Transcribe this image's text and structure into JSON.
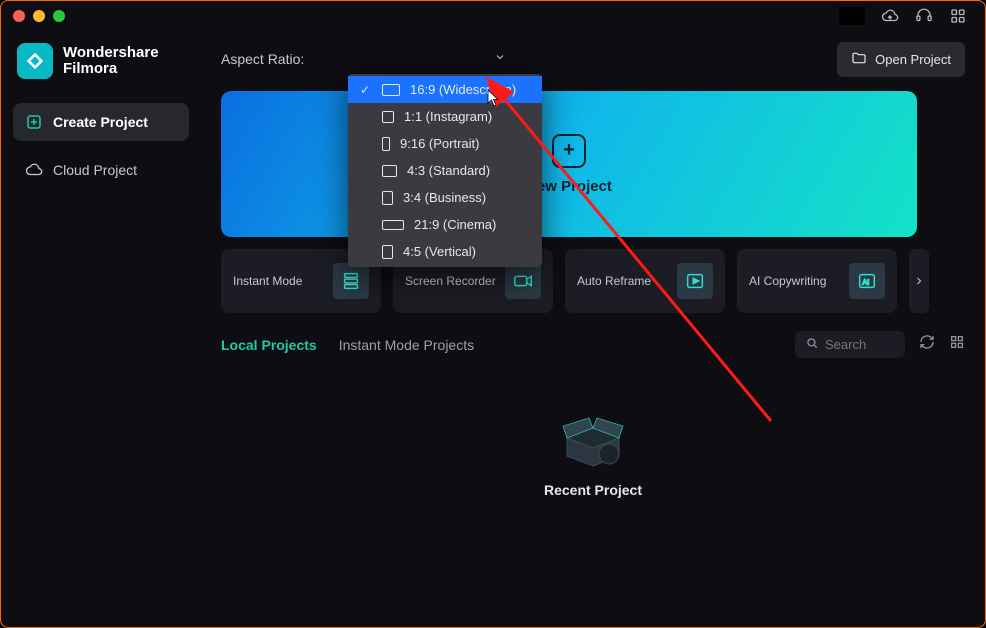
{
  "app": {
    "title_line1": "Wondershare",
    "title_line2": "Filmora"
  },
  "sidebar": {
    "items": [
      {
        "label": "Create Project",
        "icon": "plus-square-icon",
        "active": true
      },
      {
        "label": "Cloud Project",
        "icon": "cloud-icon",
        "active": false
      }
    ]
  },
  "toolbar": {
    "aspect_label": "Aspect Ratio:",
    "open_project_label": "Open Project"
  },
  "aspect_ratio": {
    "options": [
      {
        "label": "16:9 (Widescreen)",
        "shape": "wide",
        "selected": true
      },
      {
        "label": "1:1 (Instagram)",
        "shape": "square",
        "selected": false
      },
      {
        "label": "9:16 (Portrait)",
        "shape": "portrait",
        "selected": false
      },
      {
        "label": "4:3 (Standard)",
        "shape": "fourthree",
        "selected": false
      },
      {
        "label": "3:4 (Business)",
        "shape": "threefour",
        "selected": false
      },
      {
        "label": "21:9 (Cinema)",
        "shape": "wide21",
        "selected": false
      },
      {
        "label": "4:5 (Vertical)",
        "shape": "fourfive",
        "selected": false
      }
    ]
  },
  "hero": {
    "label": "New Project"
  },
  "tiles": [
    {
      "label": "Instant Mode"
    },
    {
      "label": "Screen Recorder"
    },
    {
      "label": "Auto Reframe"
    },
    {
      "label": "AI Copywriting"
    }
  ],
  "tabs": {
    "local": "Local Projects",
    "instant": "Instant Mode Projects"
  },
  "search": {
    "placeholder": "Search"
  },
  "recent": {
    "label": "Recent Project"
  }
}
